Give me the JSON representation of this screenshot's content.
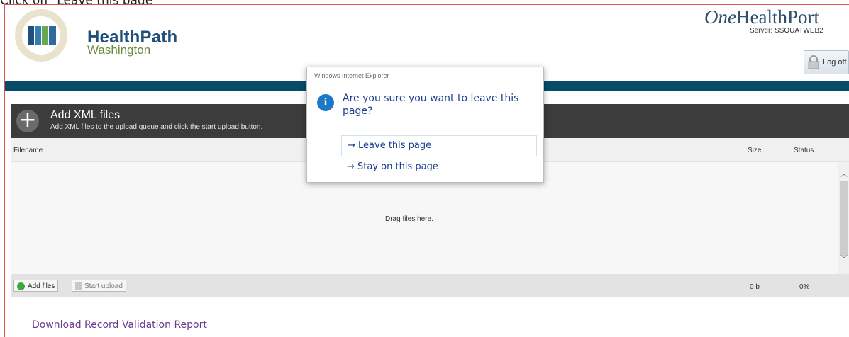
{
  "instruction": "Click on \"Leave this page\"",
  "header": {
    "brand_title": "HealthPath",
    "brand_subtitle": "Washington",
    "partner_logo_prefix": "One",
    "partner_logo_suffix": "HealthPort",
    "server_label": "Server: SSOUATWEB2",
    "logoff_label": "Log off",
    "band_color": "#064b6a"
  },
  "uploader": {
    "title": "Add XML files",
    "description": "Add XML files to the upload queue and click the start upload button.",
    "columns": {
      "filename": "Filename",
      "size": "Size",
      "status": "Status"
    },
    "drop_text": "Drag files here.",
    "add_files_label": "Add files",
    "start_upload_label": "Start upload",
    "total_size": "0 b",
    "total_status": "0%"
  },
  "download_link": "Download Record Validation Report",
  "dialog": {
    "window_title": "Windows Internet Explorer",
    "message": "Are you sure you want to leave this page?",
    "leave_option": "→ Leave this page",
    "stay_option": "→ Stay on this page",
    "accent_color": "#1b3e8a"
  }
}
